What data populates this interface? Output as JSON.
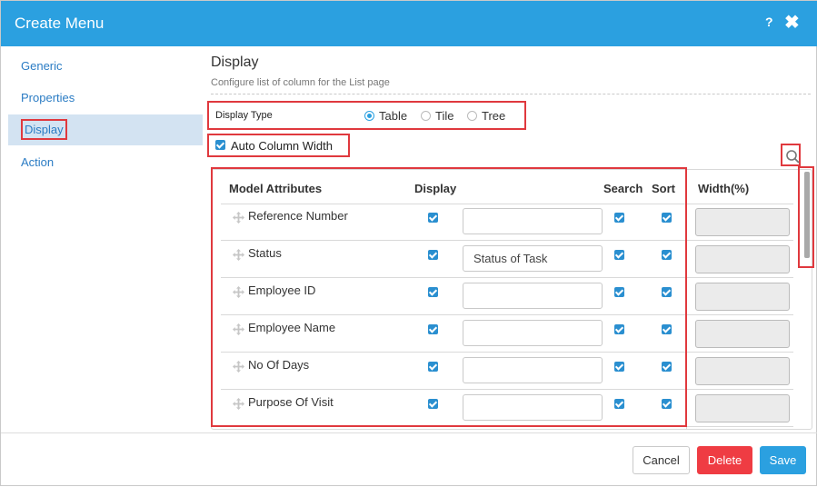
{
  "dialog": {
    "title": "Create Menu",
    "help_label": "?",
    "close_label": "✖"
  },
  "sidebar": {
    "items": [
      {
        "label": "Generic"
      },
      {
        "label": "Properties"
      },
      {
        "label": "Display",
        "active": true
      },
      {
        "label": "Action"
      }
    ]
  },
  "display": {
    "title": "Display",
    "subtitle": "Configure list of column for the List page",
    "display_type_label": "Display Type",
    "display_type_options": [
      "Table",
      "Tile",
      "Tree"
    ],
    "display_type_selected": "Table",
    "auto_column_width_label": "Auto Column Width",
    "auto_column_width_checked": true
  },
  "table": {
    "headers": {
      "attribute": "Model Attributes",
      "display": "Display",
      "search": "Search",
      "sort": "Sort",
      "width": "Width(%)"
    },
    "rows": [
      {
        "name": "Reference Number",
        "display": true,
        "description": "",
        "search": true,
        "sort": true,
        "width": ""
      },
      {
        "name": "Status",
        "display": true,
        "description": "Status of Task",
        "search": true,
        "sort": true,
        "width": ""
      },
      {
        "name": "Employee ID",
        "display": true,
        "description": "",
        "search": true,
        "sort": true,
        "width": ""
      },
      {
        "name": "Employee Name",
        "display": true,
        "description": "",
        "search": true,
        "sort": true,
        "width": ""
      },
      {
        "name": "No Of Days",
        "display": true,
        "description": "",
        "search": true,
        "sort": true,
        "width": ""
      },
      {
        "name": "Purpose Of Visit",
        "display": true,
        "description": "",
        "search": true,
        "sort": true,
        "width": ""
      }
    ]
  },
  "footer": {
    "cancel_label": "Cancel",
    "delete_label": "Delete",
    "save_label": "Save"
  },
  "colors": {
    "header_bg": "#2ba0e0",
    "active_item_bg": "#d3e3f2",
    "highlight_border": "#e0393e",
    "delete_bg": "#ef3c43",
    "save_bg": "#2ba0e0"
  }
}
